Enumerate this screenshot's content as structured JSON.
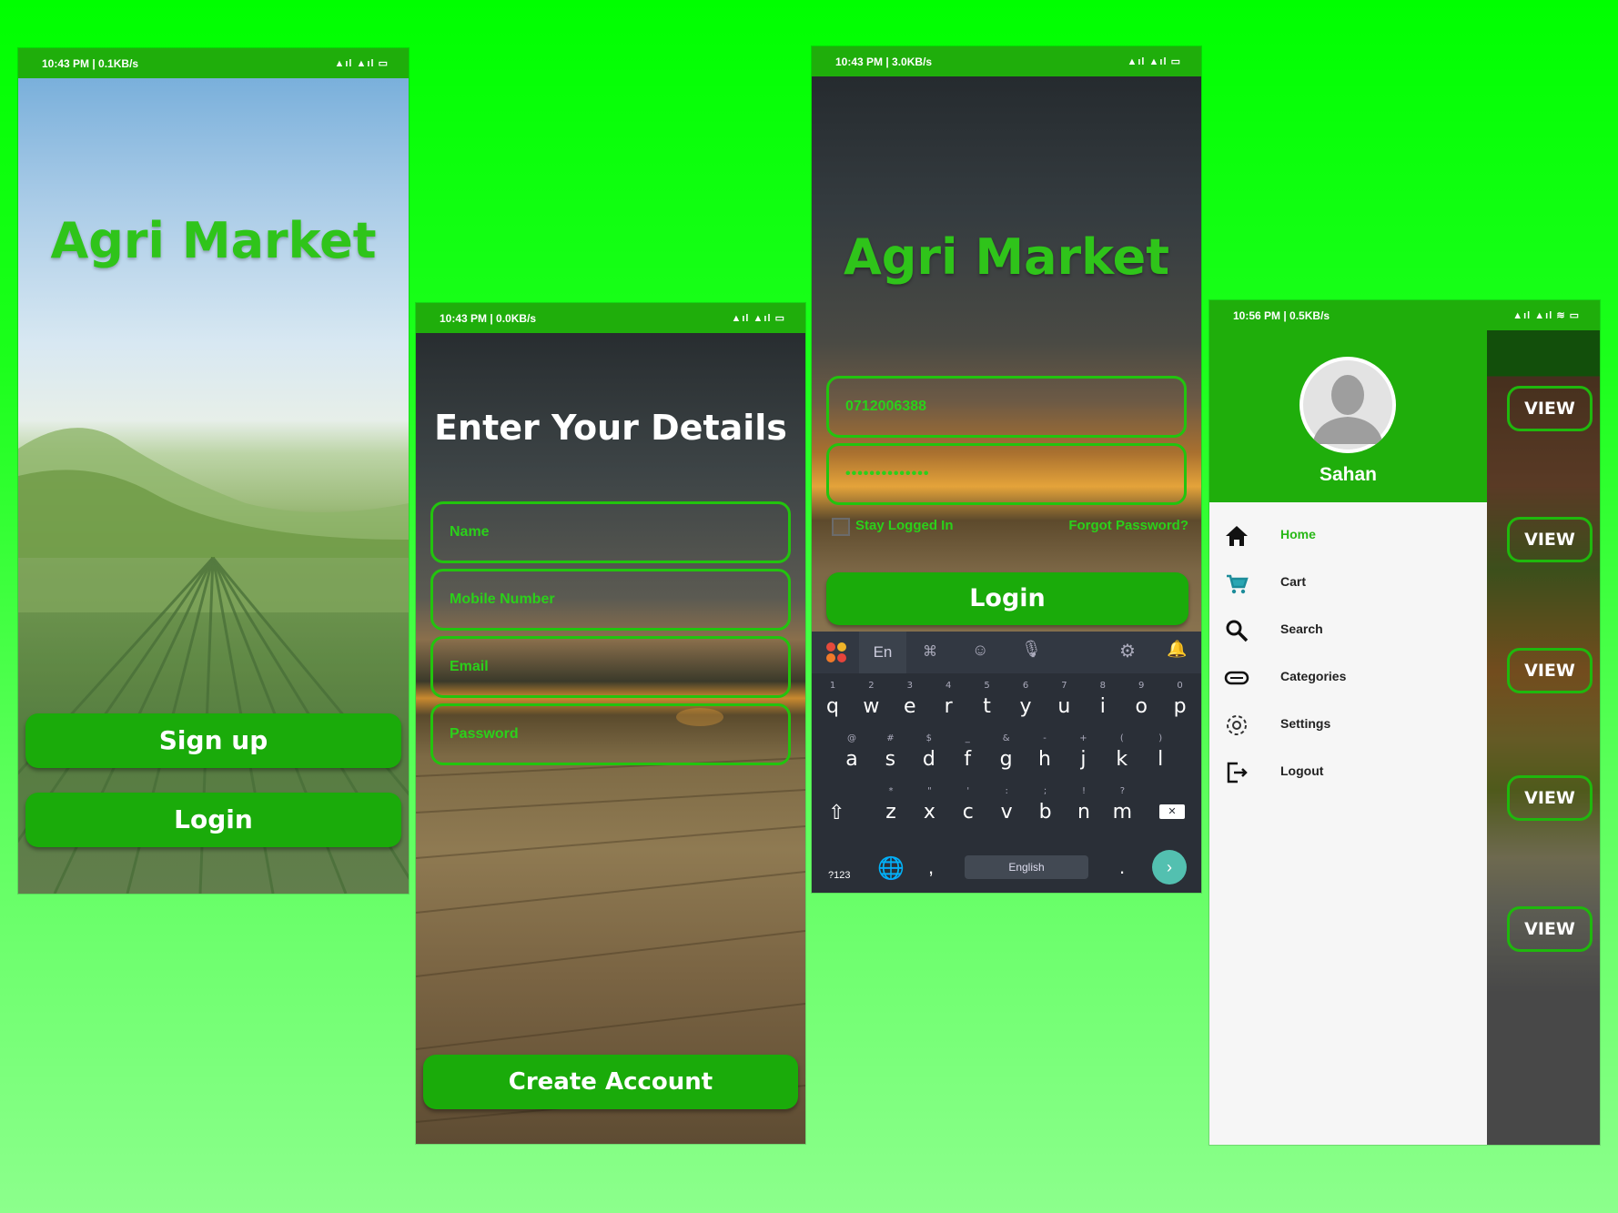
{
  "screen1": {
    "status_time": "10:43 PM | 0.1KB/s",
    "app_title": "Agri Market",
    "signup_label": "Sign up",
    "login_label": "Login"
  },
  "screen2": {
    "status_time": "10:43 PM | 0.0KB/s",
    "heading": "Enter Your Details",
    "fields": {
      "name": "Name",
      "mobile": "Mobile Number",
      "email": "Email",
      "password": "Password"
    },
    "create_label": "Create Account"
  },
  "screen3": {
    "status_time": "10:43 PM | 3.0KB/s",
    "app_title": "Agri Market",
    "phone_value": "0712006388",
    "password_value": "••••••••••••••",
    "stay_logged_in": "Stay Logged In",
    "forgot_password": "Forgot Password?",
    "login_label": "Login",
    "keyboard": {
      "lang_tab": "En",
      "row1": [
        "q",
        "w",
        "e",
        "r",
        "t",
        "y",
        "u",
        "i",
        "o",
        "p"
      ],
      "row1_hints": [
        "1",
        "2",
        "3",
        "4",
        "5",
        "6",
        "7",
        "8",
        "9",
        "0"
      ],
      "row2": [
        "a",
        "s",
        "d",
        "f",
        "g",
        "h",
        "j",
        "k",
        "l"
      ],
      "row2_hints": [
        "@",
        "#",
        "$",
        "_",
        "&",
        "-",
        "+",
        "(",
        ")"
      ],
      "row3": [
        "z",
        "x",
        "c",
        "v",
        "b",
        "n",
        "m"
      ],
      "row3_hints": [
        "*",
        "\"",
        "'",
        ":",
        ";",
        "!",
        "?"
      ],
      "sym_key": "?123",
      "comma": ",",
      "space_label": "English",
      "period": "."
    }
  },
  "screen4": {
    "status_time": "10:56 PM | 0.5KB/s",
    "user_name": "Sahan",
    "menu": [
      {
        "label": "Home",
        "icon": "home-icon",
        "active": true
      },
      {
        "label": "Cart",
        "icon": "cart-icon",
        "active": false
      },
      {
        "label": "Search",
        "icon": "search-icon",
        "active": false
      },
      {
        "label": "Categories",
        "icon": "categories-icon",
        "active": false
      },
      {
        "label": "Settings",
        "icon": "settings-icon",
        "active": false
      },
      {
        "label": "Logout",
        "icon": "logout-icon",
        "active": false
      }
    ],
    "view_label": "VIEW"
  },
  "colors": {
    "brand_green": "#1aab0a",
    "active_menu": "#28b816"
  }
}
